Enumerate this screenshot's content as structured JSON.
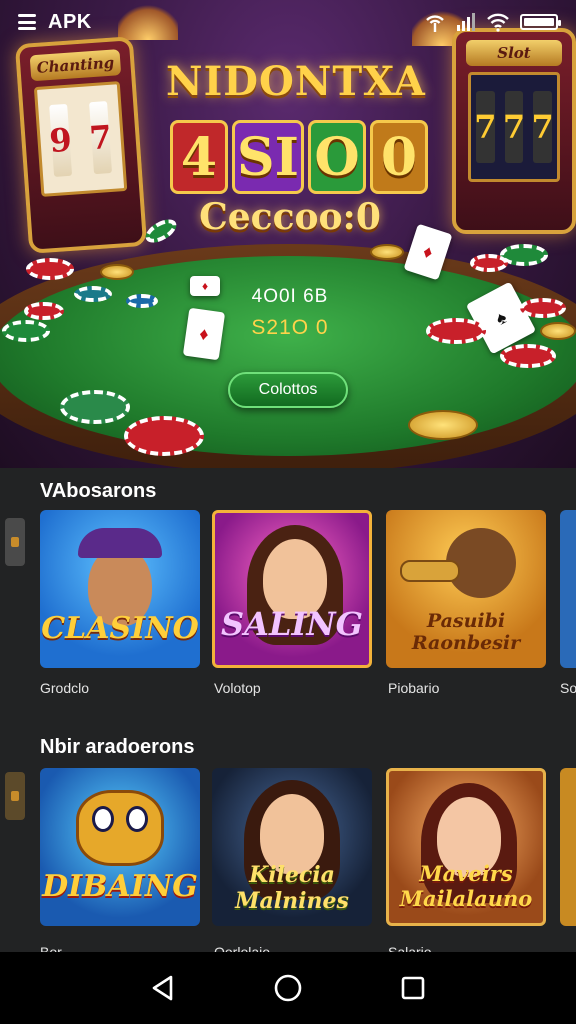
{
  "status_bar": {
    "app_label": "APK",
    "icons": [
      "menu-icon",
      "antenna-icon",
      "cell-signal-icon",
      "wifi-icon",
      "battery-icon"
    ],
    "battery_level": 1.0
  },
  "hero": {
    "logo_line1": "NIDONTXA",
    "logo_line2": [
      "4",
      "SI",
      "O",
      "0"
    ],
    "logo_line3": "Ceccoo:0",
    "table_text_line1": "4O0I 6B",
    "table_text_line2": "S21O 0",
    "button_label": "Colottos",
    "machine_left_title": "Chanting",
    "machine_left_reels": [
      "9",
      "7"
    ],
    "machine_right_title": "Slot"
  },
  "sections": [
    {
      "title": "VAbosarons",
      "games": [
        {
          "title": "CLASINO",
          "caption": "Grodclo",
          "color": "#1f7fd8"
        },
        {
          "title": "SALING",
          "caption": "Volotop",
          "color": "#9c2a9a"
        },
        {
          "title": "Pasuibi Raonbesir",
          "caption": "Piobario",
          "color": "#d48a1e"
        },
        {
          "title": "",
          "caption": "So",
          "color": "#2a6ab8"
        }
      ]
    },
    {
      "title": "Nbir aradoerons",
      "games": [
        {
          "title": "DIBAING",
          "caption": "Bor",
          "color": "#1e5fb0"
        },
        {
          "title": "Kilecia Malnines",
          "caption": "Oorlolaio",
          "color": "#2a3a5a"
        },
        {
          "title": "Maveirs Mailalauno",
          "caption": "Salario",
          "color": "#b6692a"
        },
        {
          "title": "",
          "caption": "",
          "color": "#c88a22"
        }
      ]
    }
  ],
  "nav_bar": {
    "icons": [
      "back-icon",
      "home-icon",
      "recents-icon"
    ]
  }
}
